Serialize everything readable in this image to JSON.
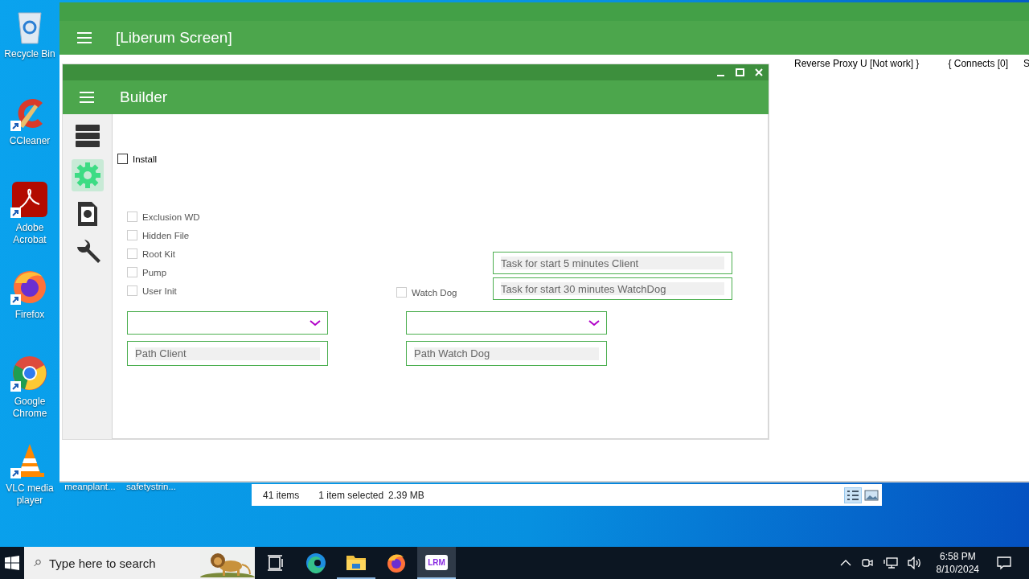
{
  "desktop_icons": [
    {
      "kind": "recycle",
      "label": "Recycle Bin",
      "shortcut": false
    },
    {
      "kind": "ccleaner",
      "label": "CCleaner",
      "shortcut": true
    },
    {
      "kind": "acrobat",
      "label": "Adobe Acrobat",
      "shortcut": true
    },
    {
      "kind": "firefox",
      "label": "Firefox",
      "shortcut": true
    },
    {
      "kind": "chrome",
      "label": "Google Chrome",
      "shortcut": true
    },
    {
      "kind": "vlc",
      "label": "VLC media player",
      "shortcut": true
    }
  ],
  "desktop_files": [
    "meanplant...",
    "safetystrin..."
  ],
  "main_window": {
    "title": "[Liberum Screen]",
    "menu": [
      "Reverse Proxy U [Not work] }",
      "{ Connects [0]",
      "S"
    ]
  },
  "builder": {
    "title": "Builder",
    "sidebar": [
      {
        "kind": "server",
        "selected": false
      },
      {
        "kind": "gear",
        "selected": true
      },
      {
        "kind": "file-gear",
        "selected": false
      },
      {
        "kind": "wrench",
        "selected": false
      }
    ],
    "install": {
      "label": "Install",
      "checked": false,
      "disabled": false
    },
    "options": [
      {
        "label": "Exclusion WD",
        "checked": false,
        "disabled": true
      },
      {
        "label": "Hidden File",
        "checked": false,
        "disabled": true
      },
      {
        "label": "Root Kit",
        "checked": false,
        "disabled": true
      },
      {
        "label": "Pump",
        "checked": false,
        "disabled": true
      },
      {
        "label": "User Init",
        "checked": false,
        "disabled": true
      }
    ],
    "watch_dog": {
      "label": "Watch Dog",
      "checked": false,
      "disabled": true
    },
    "task_fields": [
      {
        "placeholder": "Task for start 5 minutes Client"
      },
      {
        "placeholder": "Task for start 30 minutes WatchDog"
      }
    ],
    "path_fields": [
      {
        "placeholder": "Path Client"
      },
      {
        "placeholder": "Path Watch Dog"
      }
    ]
  },
  "explorer_status": {
    "items": "41 items",
    "selection": "1 item selected",
    "size": "2.39 MB"
  },
  "taskbar": {
    "search": {
      "placeholder": "Type here to search"
    },
    "apps": [
      {
        "kind": "task-view",
        "running": false,
        "active": false
      },
      {
        "kind": "edge",
        "running": false,
        "active": false
      },
      {
        "kind": "folder",
        "running": true,
        "active": false
      },
      {
        "kind": "firefox",
        "running": false,
        "active": false
      },
      {
        "kind": "app",
        "label": "LRM",
        "running": true,
        "active": true
      }
    ],
    "time": "6:58 PM",
    "date": "8/10/2024"
  }
}
